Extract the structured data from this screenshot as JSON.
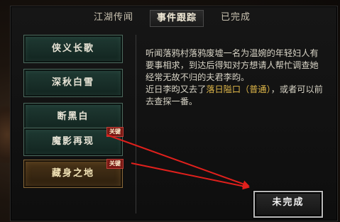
{
  "tabs": [
    {
      "label": "江湖传闻"
    },
    {
      "label": "事件跟踪",
      "active": true
    },
    {
      "label": "已完成"
    }
  ],
  "quests": [
    {
      "label": "侠义长歌",
      "badge": ""
    },
    {
      "label": "深秋白雪",
      "badge": ""
    },
    {
      "label": "断黑白",
      "badge": ""
    },
    {
      "label": "魔影再现",
      "badge": "关键"
    },
    {
      "label": "藏身之地",
      "badge": "关键",
      "selected": true
    }
  ],
  "description": {
    "line1": "听闻落鸦村落鸦废墟一名为温婉的年轻妇人有要事相求，到达后得知对方想请人帮忙调查她经常无故不归的夫君李昀。",
    "line2_prefix": "近日李昀又去了",
    "line2_location": "落日隘口（普通）",
    "line2_suffix": "，或者可以前去查探一番。"
  },
  "status_button": {
    "label": "未完成"
  },
  "colors": {
    "highlight": "#e0b84a",
    "arrow": "#e0201c"
  }
}
